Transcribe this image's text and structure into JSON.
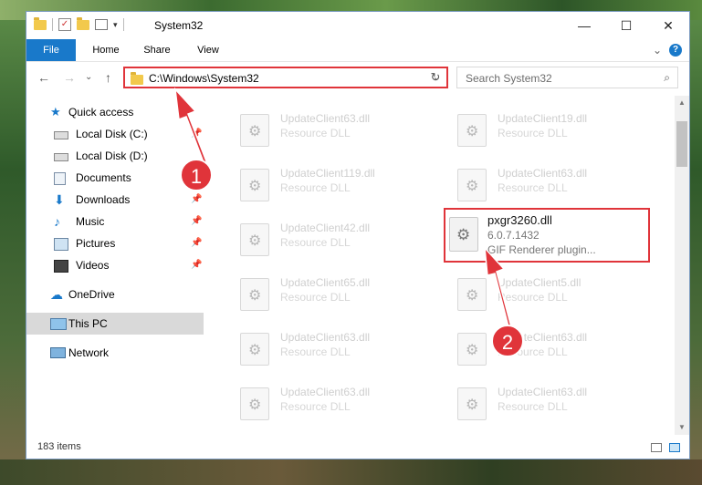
{
  "window": {
    "title": "System32"
  },
  "window_controls": {
    "minimize": "—",
    "maximize": "☐",
    "close": "✕"
  },
  "ribbon": {
    "tabs": [
      "File",
      "Home",
      "Share",
      "View"
    ],
    "help": "?",
    "collapse": "⌄"
  },
  "navigation": {
    "back": "←",
    "forward": "→",
    "history": "⌄",
    "up": "↑"
  },
  "address_bar": {
    "path": "C:\\Windows\\System32",
    "dropdown": "⌄",
    "refresh": "↻"
  },
  "search": {
    "placeholder": "Search System32",
    "icon": "⌕"
  },
  "nav_pane": {
    "quick_access": {
      "label": "Quick access",
      "icon": "star-icon"
    },
    "items": [
      {
        "label": "Local Disk (C:)",
        "icon": "drive-icon",
        "pinned": true
      },
      {
        "label": "Local Disk (D:)",
        "icon": "drive-icon",
        "pinned": false
      },
      {
        "label": "Documents",
        "icon": "documents-icon",
        "pinned": true
      },
      {
        "label": "Downloads",
        "icon": "downloads-icon",
        "pinned": true
      },
      {
        "label": "Music",
        "icon": "music-icon",
        "pinned": true
      },
      {
        "label": "Pictures",
        "icon": "pictures-icon",
        "pinned": true
      },
      {
        "label": "Videos",
        "icon": "videos-icon",
        "pinned": true
      }
    ],
    "onedrive": "OneDrive",
    "this_pc": "This PC",
    "network": "Network",
    "pin_glyph": "📌"
  },
  "files": [
    {
      "name": "UpdateClient63.dll",
      "type": "Resource DLL"
    },
    {
      "name": "UpdateClient19.dll",
      "type": "Resource DLL"
    },
    {
      "name": "UpdateClient119.dll",
      "type": "Resource DLL"
    },
    {
      "name": "UpdateClient63.dll",
      "type": "Resource DLL"
    },
    {
      "name": "UpdateClient42.dll",
      "type": "Resource DLL"
    },
    {
      "name": "UpdateClient65.dll",
      "type": "Resource DLL"
    },
    {
      "name": "UpdateClient5.dll",
      "type": "Resource DLL"
    },
    {
      "name": "UpdateClient63.dll",
      "type": "Resource DLL"
    },
    {
      "name": "UpdateClient63.dll",
      "type": "Resource DLL"
    },
    {
      "name": "UpdateClient63.dll",
      "type": "Resource DLL"
    },
    {
      "name": "UpdateClient63.dll",
      "type": "Resource DLL"
    }
  ],
  "highlighted_file": {
    "name": "pxgr3260.dll",
    "version": "6.0.7.1432",
    "description": "GIF Renderer plugin..."
  },
  "status": {
    "item_count": "183 items"
  },
  "annotations": {
    "badge_1": "1",
    "badge_2": "2",
    "accent": "#e0343a"
  }
}
